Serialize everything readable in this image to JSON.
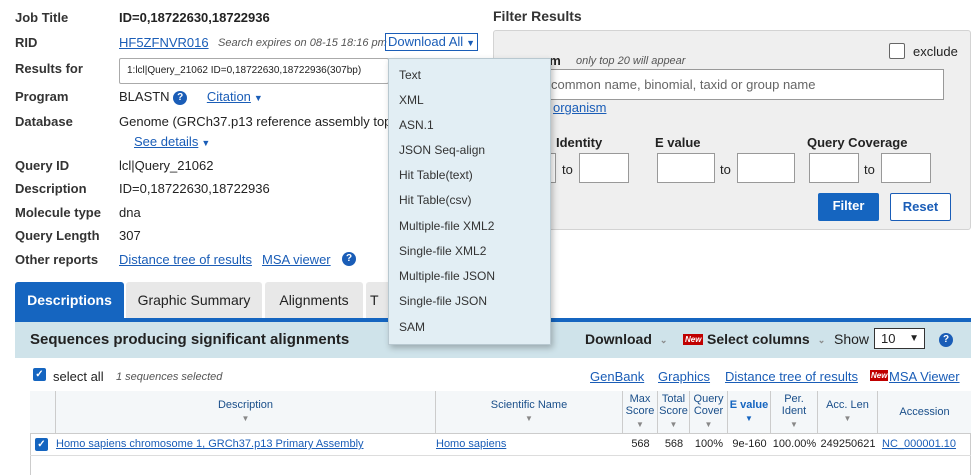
{
  "summary": {
    "job_title_label": "Job Title",
    "job_title_value": "ID=0,18722630,18722936",
    "rid_label": "RID",
    "rid_value": "HF5ZFNVR016",
    "search_expires": "Search expires on 08-15 18:16 pm",
    "download_all": "Download All",
    "results_for_label": "Results for",
    "results_for_value": "1:lcl|Query_21062 ID=0,18722630,18722936(307bp)",
    "program_label": "Program",
    "program_value": "BLASTN",
    "citation": "Citation",
    "database_label": "Database",
    "database_value": "Genome (GRCh37.p13 reference assembly top",
    "see_details": "See details",
    "query_id_label": "Query ID",
    "query_id_value": "lcl|Query_21062",
    "description_label": "Description",
    "description_value": "ID=0,18722630,18722936",
    "molecule_type_label": "Molecule type",
    "molecule_type_value": "dna",
    "query_length_label": "Query Length",
    "query_length_value": "307",
    "other_reports_label": "Other reports",
    "distance_tree": "Distance tree of results",
    "msa_viewer": "MSA viewer"
  },
  "filter": {
    "title": "Filter Results",
    "organism_label": "sm",
    "organism_hint": "only top 20 will appear",
    "exclude": "exclude",
    "organism_placeholder": "common  name, binomial, taxid or group  name",
    "add_organism": "organism",
    "identity_label": "Identity",
    "evalue_label": "E value",
    "coverage_label": "Query Coverage",
    "to": "to",
    "filter_btn": "Filter",
    "reset_btn": "Reset"
  },
  "download_menu": {
    "items": [
      "Text",
      "XML",
      "ASN.1",
      "JSON Seq-align",
      "Hit Table(text)",
      "Hit Table(csv)",
      "Multiple-file XML2",
      "Single-file XML2",
      "Multiple-file JSON",
      "Single-file JSON",
      "SAM"
    ]
  },
  "tabs": [
    "Descriptions",
    "Graphic Summary",
    "Alignments",
    "T"
  ],
  "results_bar": {
    "title": "Sequences producing significant alignments",
    "download": "Download",
    "new_badge": "New",
    "select_columns": "Select columns",
    "show": "Show",
    "show_value": "10"
  },
  "toolbar": {
    "select_all": "select all",
    "selected": "1 sequences selected",
    "genbank": "GenBank",
    "graphics": "Graphics",
    "distance_tree": "Distance tree of results",
    "new_badge": "New",
    "msa_viewer": "MSA Viewer"
  },
  "table": {
    "headers": {
      "description": "Description",
      "scientific_name": "Scientific Name",
      "max_score": "Max Score",
      "total_score": "Total Score",
      "query_cover": "Query Cover",
      "e_value": "E value",
      "per_ident": "Per. Ident",
      "acc_len": "Acc. Len",
      "accession": "Accession"
    },
    "rows": [
      {
        "description": "Homo sapiens chromosome 1, GRCh37.p13 Primary Assembly",
        "scientific_name": "Homo sapiens",
        "max_score": "568",
        "total_score": "568",
        "query_cover": "100%",
        "e_value": "9e-160",
        "per_ident": "100.00%",
        "acc_len": "249250621",
        "accession": "NC_000001.10"
      }
    ]
  },
  "colors": {
    "accent": "#1565c0",
    "results_bar": "#cfe3ea",
    "menu": "#e2eef4",
    "new_badge": "#c00000"
  }
}
